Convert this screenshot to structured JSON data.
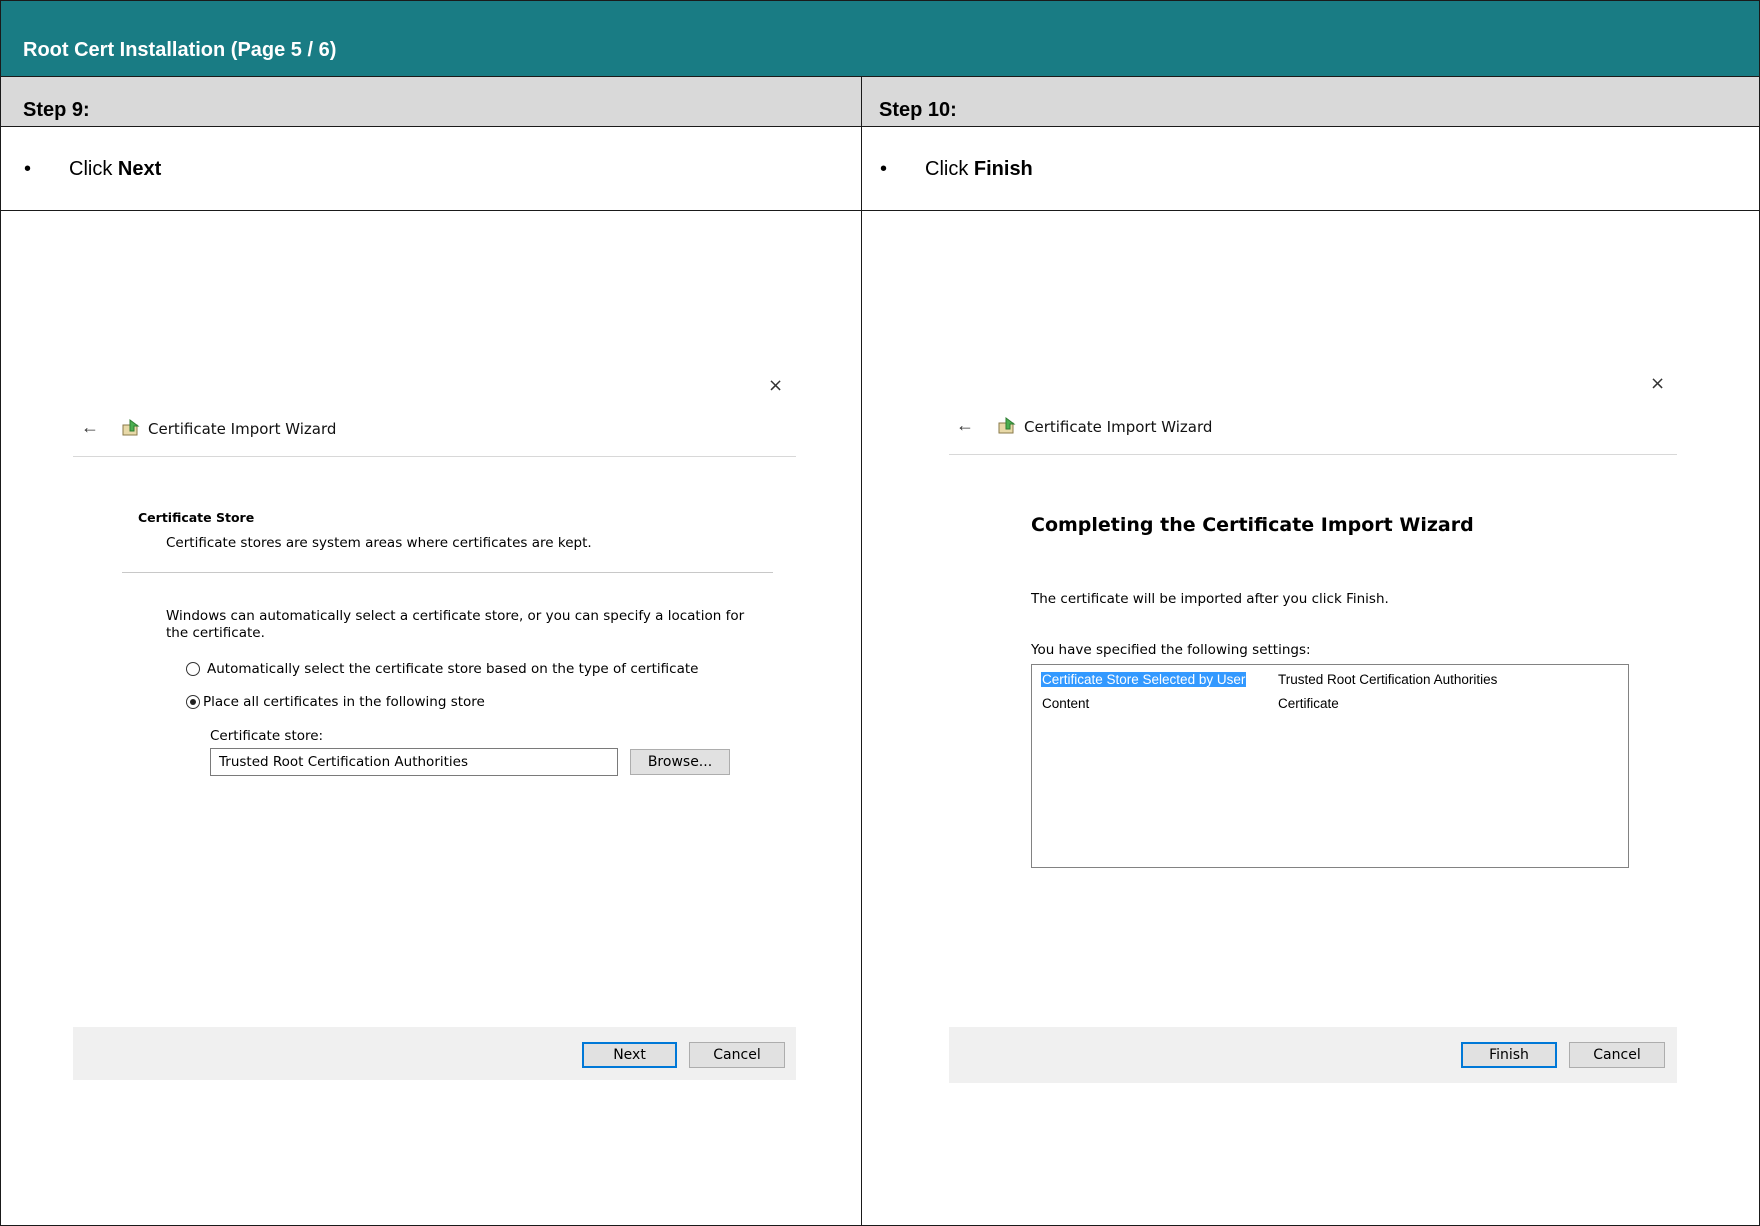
{
  "header": {
    "title": "Root Cert Installation (Page 5 / 6)"
  },
  "steps": [
    {
      "label": "Step 9:",
      "instruction_prefix": "Click ",
      "instruction_bold": "Next"
    },
    {
      "label": "Step 10:",
      "instruction_prefix": "Click ",
      "instruction_bold": "Finish"
    }
  ],
  "bullet_char": "•",
  "dialog_left": {
    "close_glyph": "×",
    "back_glyph": "←",
    "title": "Certificate Import Wizard",
    "section_title": "Certificate Store",
    "section_subtitle": "Certificate stores are system areas where certificates are kept.",
    "description_line1": "Windows can automatically select a certificate store, or you can specify a location for",
    "description_line2": "the certificate.",
    "radio_auto": {
      "label": "Automatically select the certificate store based on the type of certificate",
      "checked": false
    },
    "radio_place": {
      "label": "Place all certificates in the following store",
      "checked": true
    },
    "store_label": "Certificate store:",
    "store_value": "Trusted Root Certification Authorities",
    "browse_button": "Browse...",
    "next_button": "Next",
    "cancel_button": "Cancel"
  },
  "dialog_right": {
    "close_glyph": "×",
    "back_glyph": "←",
    "title": "Certificate Import Wizard",
    "heading": "Completing the Certificate Import Wizard",
    "info_text": "The certificate will be imported after you click Finish.",
    "settings_label": "You have specified the following settings:",
    "settings": [
      {
        "name": "Certificate Store Selected by User",
        "value": "Trusted Root Certification Authorities"
      },
      {
        "name": "Content",
        "value": "Certificate"
      }
    ],
    "finish_button": "Finish",
    "cancel_button": "Cancel"
  },
  "colors": {
    "header_bg": "#197c84",
    "step_row_bg": "#d9d9d9",
    "selection": "#3399ff",
    "default_button_border": "#0078d7"
  }
}
